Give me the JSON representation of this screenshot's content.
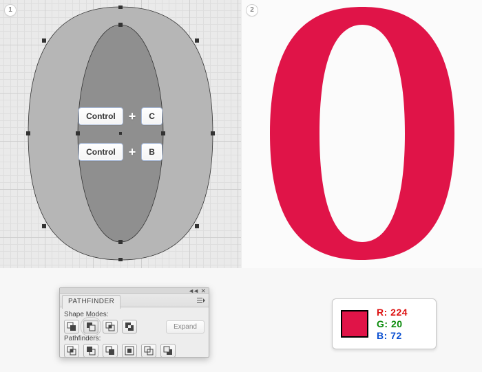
{
  "steps": {
    "one": "1",
    "two": "2"
  },
  "shortcuts": {
    "copy": {
      "mod": "Control",
      "plus": "+",
      "key": "C"
    },
    "other": {
      "mod": "Control",
      "plus": "+",
      "key": "B"
    }
  },
  "pathfinder": {
    "title": "PATHFINDER",
    "shapeModesLabel": "Shape Modes:",
    "pathfindersLabel": "Pathfinders:",
    "expandLabel": "Expand",
    "chevrons": "◄◄",
    "close": "✕"
  },
  "color": {
    "hex": "#e01448",
    "r_label": "R:",
    "r_val": "224",
    "g_label": "G:",
    "g_val": "20",
    "b_label": "B:",
    "b_val": "72"
  }
}
